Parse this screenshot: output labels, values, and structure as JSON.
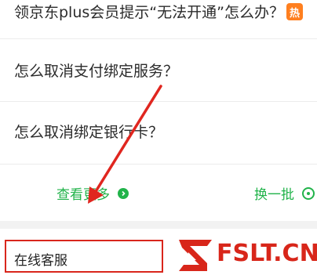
{
  "faq": {
    "items": [
      {
        "text": "领京东plus会员提示“无法开通”怎么办？",
        "badge": "热"
      },
      {
        "text": "怎么取消支付绑定服务？"
      },
      {
        "text": "怎么取消绑定银行卡？"
      }
    ]
  },
  "actions": {
    "more_label": "查看更多",
    "swap_label": "换一批"
  },
  "customer_service": {
    "label": "在线客服"
  },
  "logo": {
    "text": "FSLT.CN"
  },
  "colors": {
    "accent_green": "#21b34a",
    "hot_orange": "#ff7f1f",
    "highlight_red": "#d9261c",
    "arrow_red": "#e0261f",
    "logo_red": "#d8261a"
  }
}
